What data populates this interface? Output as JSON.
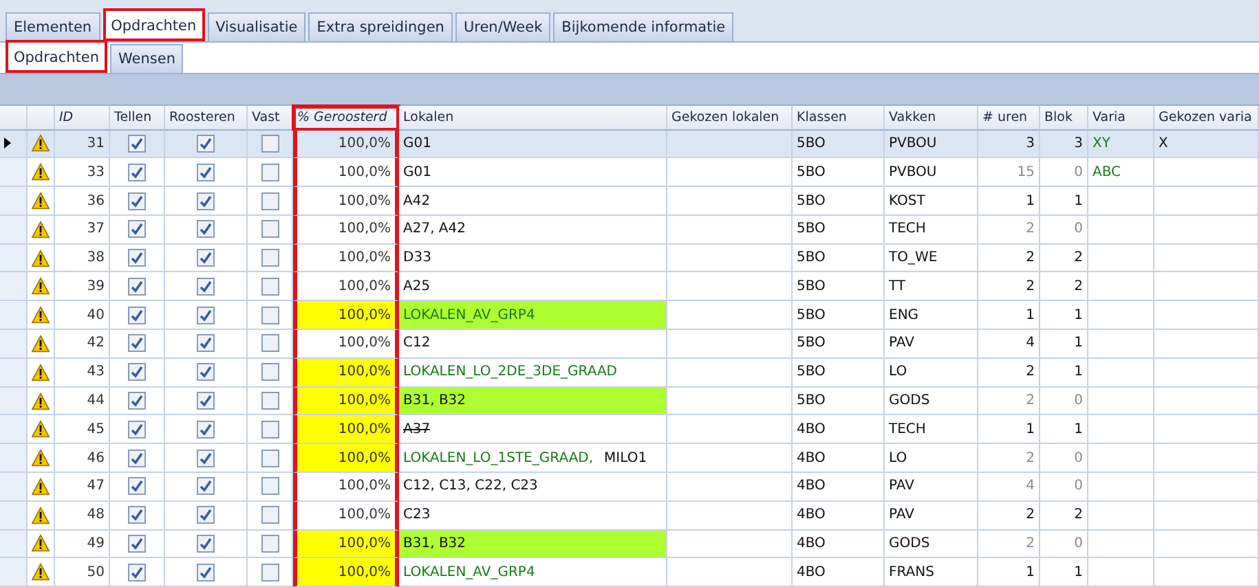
{
  "tabs": [
    {
      "label": "Elementen",
      "selected": false,
      "marked": false
    },
    {
      "label": "Opdrachten",
      "selected": true,
      "marked": true
    },
    {
      "label": "Visualisatie",
      "selected": false,
      "marked": false
    },
    {
      "label": "Extra spreidingen",
      "selected": false,
      "marked": false
    },
    {
      "label": "Uren/Week",
      "selected": false,
      "marked": false
    },
    {
      "label": "Bijkomende informatie",
      "selected": false,
      "marked": false
    }
  ],
  "subtabs": [
    {
      "label": "Opdrachten",
      "selected": true,
      "marked": true
    },
    {
      "label": "Wensen",
      "selected": false,
      "marked": false
    }
  ],
  "table": {
    "columns": [
      {
        "kind": "rowhead",
        "marked": false
      },
      {
        "kind": "icon",
        "marked": false
      },
      {
        "label": "ID",
        "kind": "id",
        "marked": false
      },
      {
        "label": "Tellen",
        "kind": "tellen",
        "marked": false
      },
      {
        "label": "Roosteren",
        "kind": "roosteren",
        "marked": false
      },
      {
        "label": "Vast",
        "kind": "vast",
        "marked": false
      },
      {
        "label": "% Geroosterd",
        "kind": "pct",
        "marked": true
      },
      {
        "label": "Lokalen",
        "kind": "lokalen",
        "marked": false
      },
      {
        "label": "Gekozen lokalen",
        "kind": "gekozen_lokalen",
        "marked": false
      },
      {
        "label": "Klassen",
        "kind": "klassen",
        "marked": false
      },
      {
        "label": "Vakken",
        "kind": "vakken",
        "marked": false
      },
      {
        "label": "# uren",
        "kind": "uren",
        "marked": false
      },
      {
        "label": "Blok",
        "kind": "blok",
        "marked": false
      },
      {
        "label": "Varia",
        "kind": "varia",
        "marked": false
      },
      {
        "label": "Gekozen varia",
        "kind": "gekozen_varia",
        "marked": false
      }
    ],
    "rows": [
      {
        "selected": true,
        "id": "31",
        "tellen": true,
        "roosteren": true,
        "vast": false,
        "pct": "100,0%",
        "pct_highlight": false,
        "lokalen": [
          {
            "text": "G01",
            "kind": "plain"
          }
        ],
        "lokalen_highlight": false,
        "klassen": "5BO",
        "vakken": "PVBOU",
        "uren": "3",
        "blok": "3",
        "dim": false,
        "varia": "XY",
        "gekozen_varia": "X"
      },
      {
        "selected": false,
        "id": "33",
        "tellen": true,
        "roosteren": true,
        "vast": false,
        "pct": "100,0%",
        "pct_highlight": false,
        "lokalen": [
          {
            "text": "G01",
            "kind": "plain"
          }
        ],
        "lokalen_highlight": false,
        "klassen": "5BO",
        "vakken": "PVBOU",
        "uren": "15",
        "blok": "0",
        "dim": true,
        "varia": "ABC"
      },
      {
        "selected": false,
        "id": "36",
        "tellen": true,
        "roosteren": true,
        "vast": false,
        "pct": "100,0%",
        "pct_highlight": false,
        "lokalen": [
          {
            "text": "A42",
            "kind": "plain"
          }
        ],
        "lokalen_highlight": false,
        "klassen": "5BO",
        "vakken": "KOST",
        "uren": "1",
        "blok": "1",
        "dim": false
      },
      {
        "selected": false,
        "id": "37",
        "tellen": true,
        "roosteren": true,
        "vast": false,
        "pct": "100,0%",
        "pct_highlight": false,
        "lokalen": [
          {
            "text": "A27, A42",
            "kind": "plain"
          }
        ],
        "lokalen_highlight": false,
        "klassen": "5BO",
        "vakken": "TECH",
        "uren": "2",
        "blok": "0",
        "dim": true
      },
      {
        "selected": false,
        "id": "38",
        "tellen": true,
        "roosteren": true,
        "vast": false,
        "pct": "100,0%",
        "pct_highlight": false,
        "lokalen": [
          {
            "text": "D33",
            "kind": "plain"
          }
        ],
        "lokalen_highlight": false,
        "klassen": "5BO",
        "vakken": "TO_WE",
        "uren": "2",
        "blok": "2",
        "dim": false
      },
      {
        "selected": false,
        "id": "39",
        "tellen": true,
        "roosteren": true,
        "vast": false,
        "pct": "100,0%",
        "pct_highlight": false,
        "lokalen": [
          {
            "text": "A25",
            "kind": "plain"
          }
        ],
        "lokalen_highlight": false,
        "klassen": "5BO",
        "vakken": "TT",
        "uren": "2",
        "blok": "2",
        "dim": false
      },
      {
        "selected": false,
        "id": "40",
        "tellen": true,
        "roosteren": true,
        "vast": false,
        "pct": "100,0%",
        "pct_highlight": true,
        "lokalen": [
          {
            "text": "LOKALEN_AV_GRP4",
            "kind": "group"
          }
        ],
        "lokalen_highlight": true,
        "klassen": "5BO",
        "vakken": "ENG",
        "uren": "1",
        "blok": "1",
        "dim": false
      },
      {
        "selected": false,
        "id": "42",
        "tellen": true,
        "roosteren": true,
        "vast": false,
        "pct": "100,0%",
        "pct_highlight": false,
        "lokalen": [
          {
            "text": "C12",
            "kind": "plain"
          }
        ],
        "lokalen_highlight": false,
        "klassen": "5BO",
        "vakken": "PAV",
        "uren": "4",
        "blok": "1",
        "dim": false
      },
      {
        "selected": false,
        "id": "43",
        "tellen": true,
        "roosteren": true,
        "vast": false,
        "pct": "100,0%",
        "pct_highlight": true,
        "lokalen": [
          {
            "text": "LOKALEN_LO_2DE_3DE_GRAAD",
            "kind": "group"
          }
        ],
        "lokalen_highlight": false,
        "klassen": "5BO",
        "vakken": "LO",
        "uren": "2",
        "blok": "1",
        "dim": false
      },
      {
        "selected": false,
        "id": "44",
        "tellen": true,
        "roosteren": true,
        "vast": false,
        "pct": "100,0%",
        "pct_highlight": true,
        "lokalen": [
          {
            "text": "B31, B32",
            "kind": "plain"
          }
        ],
        "lokalen_highlight": true,
        "klassen": "5BO",
        "vakken": "GODS",
        "uren": "2",
        "blok": "0",
        "dim": true
      },
      {
        "selected": false,
        "id": "45",
        "tellen": true,
        "roosteren": true,
        "vast": false,
        "pct": "100,0%",
        "pct_highlight": true,
        "lokalen": [
          {
            "text": "A37",
            "kind": "struck"
          }
        ],
        "lokalen_highlight": false,
        "klassen": "4BO",
        "vakken": "TECH",
        "uren": "1",
        "blok": "1",
        "dim": false
      },
      {
        "selected": false,
        "id": "46",
        "tellen": true,
        "roosteren": true,
        "vast": false,
        "pct": "100,0%",
        "pct_highlight": true,
        "lokalen": [
          {
            "text": "LOKALEN_LO_1STE_GRAAD,",
            "kind": "group"
          },
          {
            "text": "MILO1",
            "kind": "plain"
          }
        ],
        "lokalen_highlight": false,
        "klassen": "4BO",
        "vakken": "LO",
        "uren": "2",
        "blok": "0",
        "dim": true
      },
      {
        "selected": false,
        "id": "47",
        "tellen": true,
        "roosteren": true,
        "vast": false,
        "pct": "100,0%",
        "pct_highlight": false,
        "lokalen": [
          {
            "text": "C12, C13, C22, C23",
            "kind": "plain"
          }
        ],
        "lokalen_highlight": false,
        "klassen": "4BO",
        "vakken": "PAV",
        "uren": "4",
        "blok": "0",
        "dim": true
      },
      {
        "selected": false,
        "id": "48",
        "tellen": true,
        "roosteren": true,
        "vast": false,
        "pct": "100,0%",
        "pct_highlight": false,
        "lokalen": [
          {
            "text": "C23",
            "kind": "plain"
          }
        ],
        "lokalen_highlight": false,
        "klassen": "4BO",
        "vakken": "PAV",
        "uren": "2",
        "blok": "2",
        "dim": false
      },
      {
        "selected": false,
        "id": "49",
        "tellen": true,
        "roosteren": true,
        "vast": false,
        "pct": "100,0%",
        "pct_highlight": true,
        "lokalen": [
          {
            "text": "B31, B32",
            "kind": "plain"
          }
        ],
        "lokalen_highlight": true,
        "klassen": "4BO",
        "vakken": "GODS",
        "uren": "2",
        "blok": "0",
        "dim": true
      },
      {
        "selected": false,
        "id": "50",
        "tellen": true,
        "roosteren": true,
        "vast": false,
        "pct": "100,0%",
        "pct_highlight": true,
        "lokalen": [
          {
            "text": "LOKALEN_AV_GRP4",
            "kind": "group"
          }
        ],
        "lokalen_highlight": false,
        "klassen": "4BO",
        "vakken": "FRANS",
        "uren": "1",
        "blok": "1",
        "dim": false
      }
    ]
  }
}
